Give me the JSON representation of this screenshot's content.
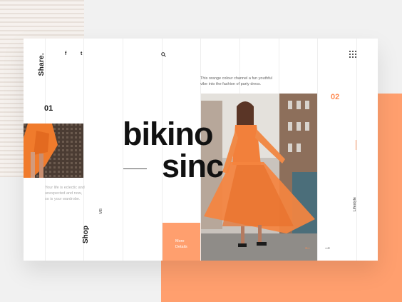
{
  "header": {
    "share_label": "Share.",
    "social": {
      "facebook": "f",
      "twitter": "t"
    }
  },
  "slides": {
    "current": "01",
    "next": "02"
  },
  "hero": {
    "title_line1": "bikino",
    "title_line2": "sinc",
    "intro": "This orange colour channel a fun youthful vibe into the fashion of party dress.",
    "side_text": "Your life is eclectic and unexpected and now, so is your wardrobe.",
    "more_button": [
      "More",
      "Details"
    ]
  },
  "footer": {
    "shop_label": "Shop",
    "lifestyle_label": "Lifestyle",
    "small_mark": "MB",
    "prev_arrow": "←",
    "next_arrow": "→"
  },
  "colors": {
    "accent": "#ff9f6e",
    "accent_dark": "#ff8a50",
    "text": "#111111",
    "card": "#ffffff"
  },
  "icons": [
    "facebook-icon",
    "twitter-icon",
    "search-icon",
    "grid-menu-icon",
    "arrow-left-icon",
    "arrow-right-icon"
  ]
}
